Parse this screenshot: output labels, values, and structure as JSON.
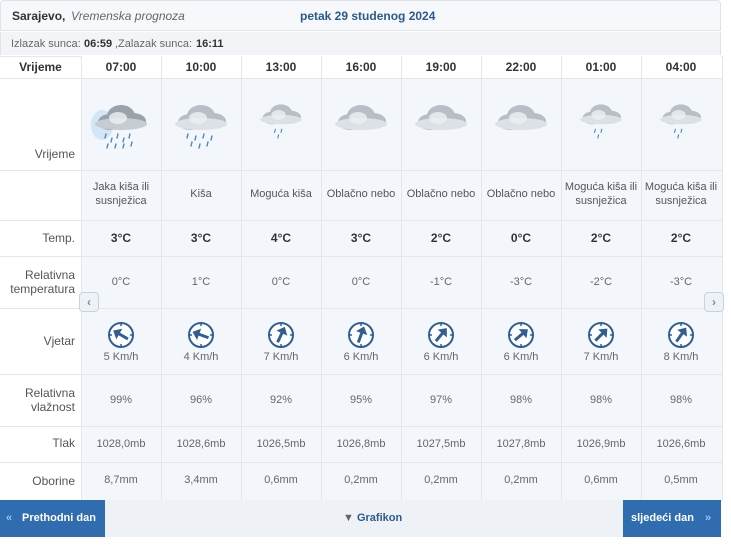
{
  "header": {
    "city": "Sarajevo,",
    "subtitle": "Vremenska prognoza",
    "date": "petak 29 studenog 2024"
  },
  "sun": {
    "sunrise_label": "Izlazak sunca:",
    "sunrise": "06:59",
    "sunset_label": ",Zalazak sunca:",
    "sunset": "16:11"
  },
  "table": {
    "time_label": "Vrijeme",
    "row_labels": {
      "weather": "Vrijeme",
      "temp": "Temp.",
      "relative_temp_1": "Relativna",
      "relative_temp_2": "temperatura",
      "wind": "Vjetar",
      "humidity_1": "Relativna",
      "humidity_2": "vlažnost",
      "pressure": "Tlak",
      "precip": "Oborine"
    },
    "hours": [
      {
        "time": "07:00",
        "icon": "heavy-rain-cloud-icon",
        "desc1": "Jaka kiša ili",
        "desc2": "susnježica",
        "temp": "3°C",
        "rel": "0°C",
        "wind_dir": 120,
        "wind": "5 Km/h",
        "hum": "99%",
        "press": "1028,0mb",
        "precip": "8,7mm"
      },
      {
        "time": "10:00",
        "icon": "rain-cloud-icon",
        "desc1": "Kiša",
        "desc2": "",
        "temp": "3°C",
        "rel": "1°C",
        "wind_dir": 110,
        "wind": "4 Km/h",
        "hum": "96%",
        "press": "1028,6mb",
        "precip": "3,4mm"
      },
      {
        "time": "13:00",
        "icon": "light-rain-cloud-icon",
        "desc1": "Moguća kiša",
        "desc2": "",
        "temp": "4°C",
        "rel": "0°C",
        "wind_dir": 205,
        "wind": "7 Km/h",
        "hum": "92%",
        "press": "1026,5mb",
        "precip": "0,6mm"
      },
      {
        "time": "16:00",
        "icon": "cloud-icon",
        "desc1": "Oblačno nebo",
        "desc2": "",
        "temp": "3°C",
        "rel": "0°C",
        "wind_dir": 200,
        "wind": "6 Km/h",
        "hum": "95%",
        "press": "1026,8mb",
        "precip": "0,2mm"
      },
      {
        "time": "19:00",
        "icon": "cloud-icon",
        "desc1": "Oblačno nebo",
        "desc2": "",
        "temp": "2°C",
        "rel": "-1°C",
        "wind_dir": 220,
        "wind": "6 Km/h",
        "hum": "97%",
        "press": "1027,5mb",
        "precip": "0,2mm"
      },
      {
        "time": "22:00",
        "icon": "cloud-icon",
        "desc1": "Oblačno nebo",
        "desc2": "",
        "temp": "0°C",
        "rel": "-3°C",
        "wind_dir": 230,
        "wind": "6 Km/h",
        "hum": "98%",
        "press": "1027,8mb",
        "precip": "0,2mm"
      },
      {
        "time": "01:00",
        "icon": "light-rain-cloud-icon",
        "desc1": "Moguća kiša ili",
        "desc2": "susnježica",
        "temp": "2°C",
        "rel": "-2°C",
        "wind_dir": 225,
        "wind": "7 Km/h",
        "hum": "98%",
        "press": "1026,9mb",
        "precip": "0,6mm"
      },
      {
        "time": "04:00",
        "icon": "light-rain-cloud-icon",
        "desc1": "Moguća kiša ili",
        "desc2": "susnježica",
        "temp": "2°C",
        "rel": "-3°C",
        "wind_dir": 215,
        "wind": "8 Km/h",
        "hum": "98%",
        "press": "1026,6mb",
        "precip": "0,5mm"
      }
    ]
  },
  "footer": {
    "prev": "Prethodni dan",
    "chart": "Grafikon",
    "next": "sljedeći dan"
  },
  "colors": {
    "accent": "#2f6db0",
    "wind_icon": "#2f5f95",
    "highlight_col": "#eaf1f9"
  }
}
